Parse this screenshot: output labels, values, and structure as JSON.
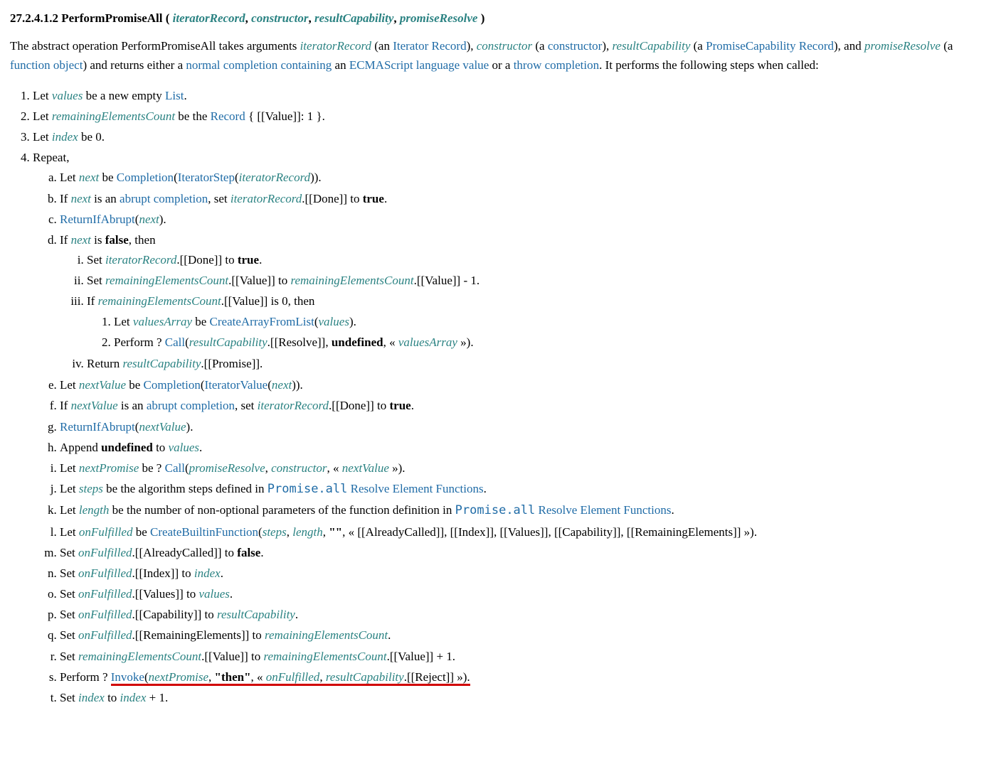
{
  "heading": {
    "num": "27.2.4.1.2",
    "name": "PerformPromiseAll",
    "params": [
      "iteratorRecord",
      "constructor",
      "resultCapability",
      "promiseResolve"
    ]
  },
  "intro": {
    "t1": "The abstract operation PerformPromiseAll takes arguments ",
    "p1": "iteratorRecord",
    "t2": " (an ",
    "l1": "Iterator Record",
    "t3": "), ",
    "p2": "constructor",
    "t4": " (a ",
    "l2": "constructor",
    "t5": "), ",
    "p3": "resultCapability",
    "t6": " (a ",
    "l3": "PromiseCapability Record",
    "t7": "), and ",
    "p4": "promiseResolve",
    "t8": " (a ",
    "l4": "function object",
    "t9": ") and returns either a ",
    "l5": "normal completion containing",
    "t10": " an ",
    "l6": "ECMAScript language value",
    "t11": " or a ",
    "l7": "throw completion",
    "t12": ". It performs the following steps when called:"
  },
  "steps": {
    "s1": {
      "a": "Let ",
      "v": "values",
      "b": " be a new empty ",
      "l": "List",
      "c": "."
    },
    "s2": {
      "a": "Let ",
      "v": "remainingElementsCount",
      "b": " be the ",
      "l": "Record",
      "c": " { [[Value]]: 1 }."
    },
    "s3": {
      "a": "Let ",
      "v": "index",
      "b": " be 0."
    },
    "s4": "Repeat,",
    "a": {
      "t1": "Let ",
      "v1": "next",
      "t2": " be ",
      "l1": "Completion",
      "t3": "(",
      "l2": "IteratorStep",
      "t4": "(",
      "v2": "iteratorRecord",
      "t5": "))."
    },
    "b": {
      "t1": "If ",
      "v1": "next",
      "t2": " is an ",
      "l1": "abrupt completion",
      "t3": ", set ",
      "v2": "iteratorRecord",
      "t4": ".[[Done]] to ",
      "bold": "true",
      "t5": "."
    },
    "c": {
      "l1": "ReturnIfAbrupt",
      "t1": "(",
      "v1": "next",
      "t2": ")."
    },
    "d": {
      "t1": "If ",
      "v1": "next",
      "t2": " is ",
      "bold": "false",
      "t3": ", then"
    },
    "d_i": {
      "t1": "Set ",
      "v1": "iteratorRecord",
      "t2": ".[[Done]] to ",
      "bold": "true",
      "t3": "."
    },
    "d_ii": {
      "t1": "Set ",
      "v1": "remainingElementsCount",
      "t2": ".[[Value]] to ",
      "v2": "remainingElementsCount",
      "t3": ".[[Value]] - 1."
    },
    "d_iii": {
      "t1": "If ",
      "v1": "remainingElementsCount",
      "t2": ".[[Value]] is 0, then"
    },
    "d_iii_1": {
      "t1": "Let ",
      "v1": "valuesArray",
      "t2": " be ",
      "l1": "CreateArrayFromList",
      "t3": "(",
      "v2": "values",
      "t4": ")."
    },
    "d_iii_2": {
      "t1": "Perform ? ",
      "l1": "Call",
      "t2": "(",
      "v1": "resultCapability",
      "t3": ".[[Resolve]], ",
      "bold": "undefined",
      "t4": ", « ",
      "v2": "valuesArray",
      "t5": " »)."
    },
    "d_iv": {
      "t1": "Return ",
      "v1": "resultCapability",
      "t2": ".[[Promise]]."
    },
    "e": {
      "t1": "Let ",
      "v1": "nextValue",
      "t2": " be ",
      "l1": "Completion",
      "t3": "(",
      "l2": "IteratorValue",
      "t4": "(",
      "v2": "next",
      "t5": "))."
    },
    "f": {
      "t1": "If ",
      "v1": "nextValue",
      "t2": " is an ",
      "l1": "abrupt completion",
      "t3": ", set ",
      "v2": "iteratorRecord",
      "t4": ".[[Done]] to ",
      "bold": "true",
      "t5": "."
    },
    "g": {
      "l1": "ReturnIfAbrupt",
      "t1": "(",
      "v1": "nextValue",
      "t2": ")."
    },
    "h": {
      "t1": "Append ",
      "bold": "undefined",
      "t2": " to ",
      "v1": "values",
      "t3": "."
    },
    "i": {
      "t1": "Let ",
      "v1": "nextPromise",
      "t2": " be ? ",
      "l1": "Call",
      "t3": "(",
      "v2": "promiseResolve",
      "t4": ", ",
      "v3": "constructor",
      "t5": ", « ",
      "v4": "nextValue",
      "t6": " »)."
    },
    "j": {
      "t1": "Let ",
      "v1": "steps",
      "t2": " be the algorithm steps defined in ",
      "code": "Promise.all",
      "l1": " Resolve Element Functions",
      "t3": "."
    },
    "k": {
      "t1": "Let ",
      "v1": "length",
      "t2": " be the number of non-optional parameters of the function definition in ",
      "code": "Promise.all",
      "l1": " Resolve Element Functions",
      "t3": "."
    },
    "l": {
      "t1": "Let ",
      "v1": "onFulfilled",
      "t2": " be ",
      "l1": "CreateBuiltinFunction",
      "t3": "(",
      "v2": "steps",
      "t4": ", ",
      "v3": "length",
      "t5": ", ",
      "bold": "\"\"",
      "t6": ", « [[AlreadyCalled]], [[Index]], [[Values]], [[Capability]], [[RemainingElements]] »)."
    },
    "m": {
      "t1": "Set ",
      "v1": "onFulfilled",
      "t2": ".[[AlreadyCalled]] to ",
      "bold": "false",
      "t3": "."
    },
    "n": {
      "t1": "Set ",
      "v1": "onFulfilled",
      "t2": ".[[Index]] to ",
      "v2": "index",
      "t3": "."
    },
    "o": {
      "t1": "Set ",
      "v1": "onFulfilled",
      "t2": ".[[Values]] to ",
      "v2": "values",
      "t3": "."
    },
    "p": {
      "t1": "Set ",
      "v1": "onFulfilled",
      "t2": ".[[Capability]] to ",
      "v2": "resultCapability",
      "t3": "."
    },
    "q": {
      "t1": "Set ",
      "v1": "onFulfilled",
      "t2": ".[[RemainingElements]] to ",
      "v2": "remainingElementsCount",
      "t3": "."
    },
    "r": {
      "t1": "Set ",
      "v1": "remainingElementsCount",
      "t2": ".[[Value]] to ",
      "v2": "remainingElementsCount",
      "t3": ".[[Value]] + 1."
    },
    "s": {
      "t1": "Perform ? ",
      "l1": "Invoke",
      "t2": "(",
      "v1": "nextPromise",
      "t3": ", ",
      "bold": "\"then\"",
      "t4": ", « ",
      "v2": "onFulfilled",
      "t5": ", ",
      "v3": "resultCapability",
      "t6": ".[[Reject]] »)."
    },
    "t": {
      "t1": "Set ",
      "v1": "index",
      "t2": " to ",
      "v2": "index",
      "t3": " + 1."
    }
  }
}
